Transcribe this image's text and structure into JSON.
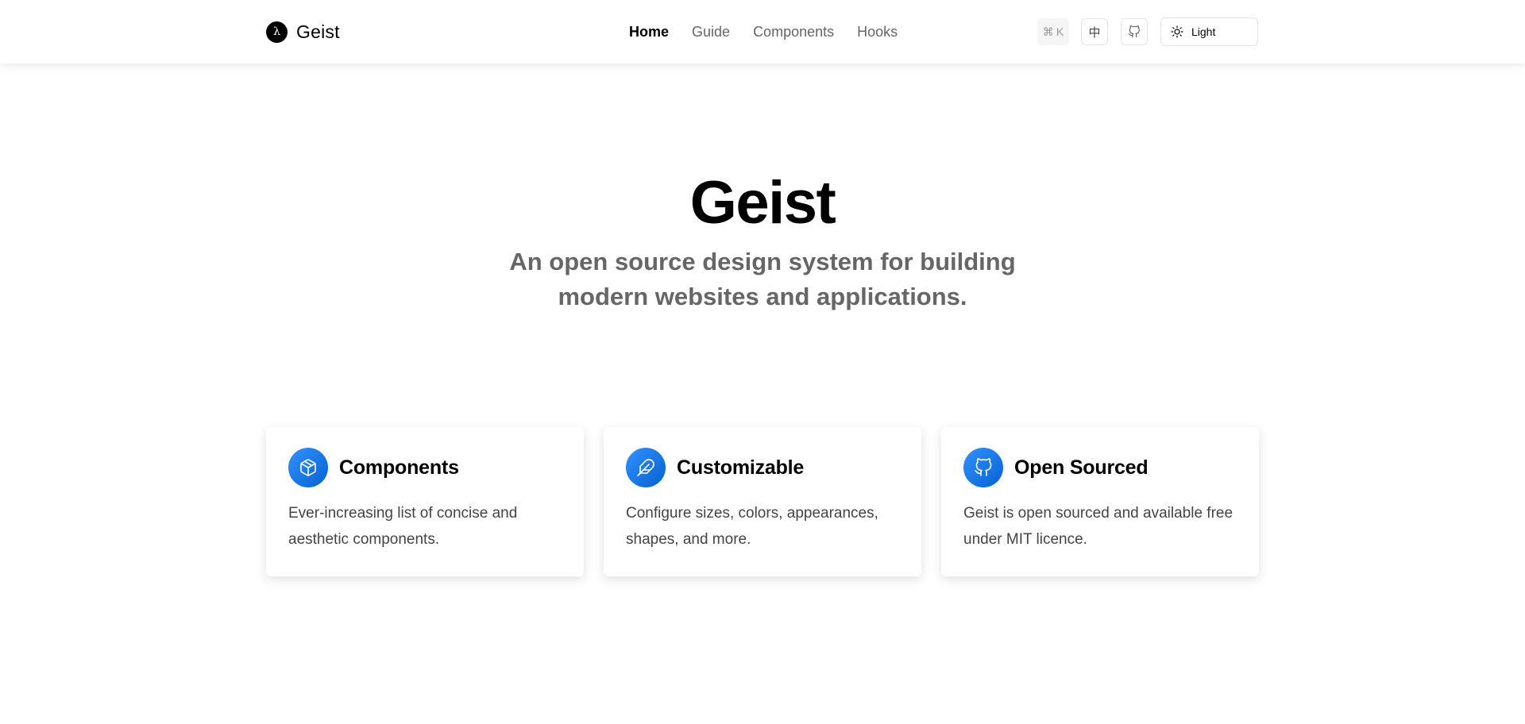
{
  "brand": {
    "logo_glyph": "λ",
    "name": "Geist"
  },
  "nav": [
    {
      "label": "Home",
      "active": true
    },
    {
      "label": "Guide",
      "active": false
    },
    {
      "label": "Components",
      "active": false
    },
    {
      "label": "Hooks",
      "active": false
    }
  ],
  "tools": {
    "search_shortcut_symbol": "⌘",
    "search_shortcut_key": "K",
    "language_label": "中",
    "theme_label": "Light"
  },
  "hero": {
    "title": "Geist",
    "subtitle_line1": "An open source design system for building",
    "subtitle_line2": "modern websites and applications."
  },
  "cards": [
    {
      "title": "Components",
      "description": "Ever-increasing list of concise and aesthetic components.",
      "icon": "package-icon"
    },
    {
      "title": "Customizable",
      "description": "Configure sizes, colors, appearances, shapes, and more.",
      "icon": "feather-icon"
    },
    {
      "title": "Open Sourced",
      "description": "Geist is open sourced and available free under MIT licence.",
      "icon": "github-icon"
    }
  ],
  "colors": {
    "accent_start": "#3291ff",
    "accent_end": "#0761d1",
    "muted_text": "#666666"
  }
}
